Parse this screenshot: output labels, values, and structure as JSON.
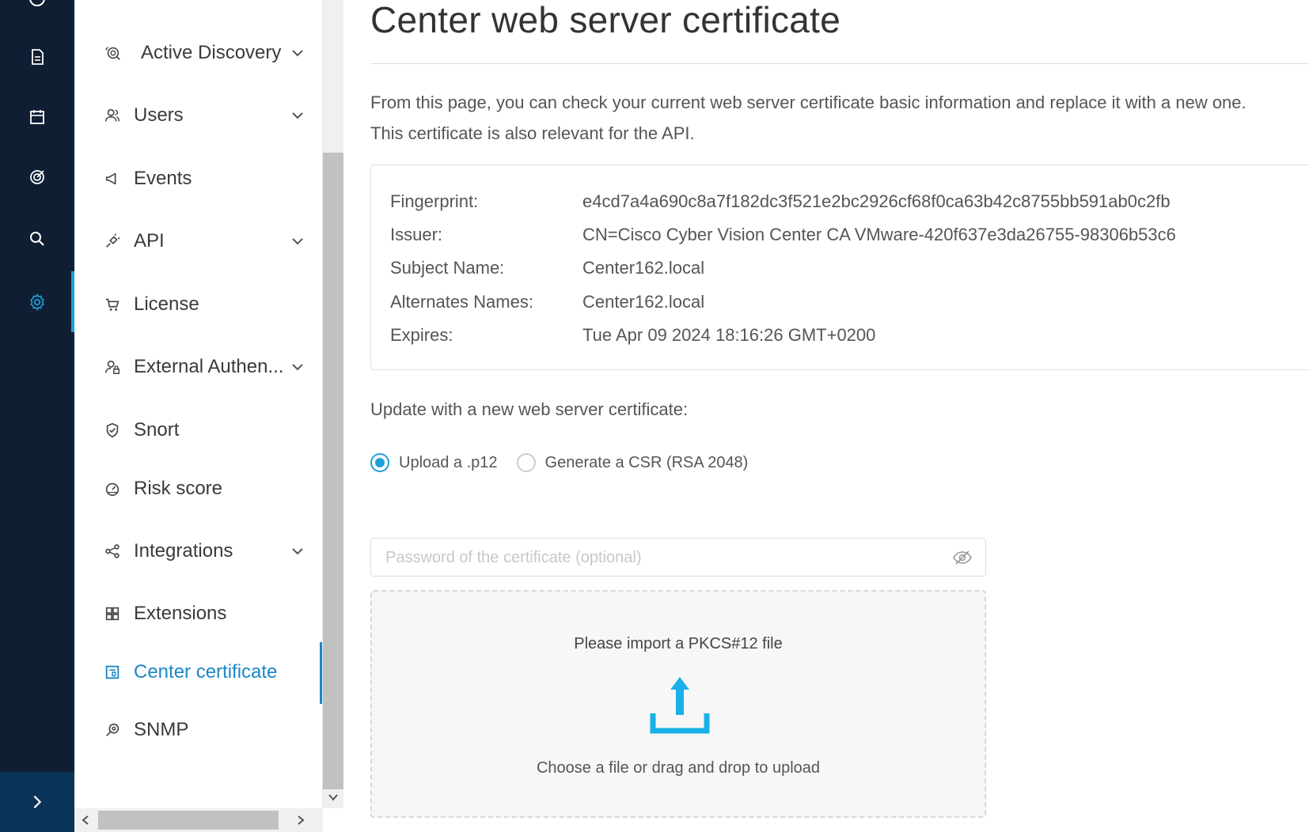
{
  "rail": {
    "icons": [
      "top-partial-icon",
      "report-icon",
      "calendar-icon",
      "target-icon",
      "search-icon",
      "gear-icon"
    ],
    "active_color": "#1ea0d8",
    "expand_icon": "chevron-right-icon"
  },
  "nav": {
    "items": [
      {
        "label": "Active Discovery",
        "icon": "discovery-icon",
        "expandable": true
      },
      {
        "label": "Users",
        "icon": "users-icon",
        "expandable": true
      },
      {
        "label": "Events",
        "icon": "megaphone-icon",
        "expandable": false
      },
      {
        "label": "API",
        "icon": "plug-icon",
        "expandable": true
      },
      {
        "label": "License",
        "icon": "cart-icon",
        "expandable": false
      },
      {
        "label": "External Authen...",
        "icon": "user-lock-icon",
        "expandable": true
      },
      {
        "label": "Snort",
        "icon": "shield-check-icon",
        "expandable": false
      },
      {
        "label": "Risk score",
        "icon": "gauge-icon",
        "expandable": false
      },
      {
        "label": "Integrations",
        "icon": "share-icon",
        "expandable": true
      },
      {
        "label": "Extensions",
        "icon": "grid-icon",
        "expandable": false
      },
      {
        "label": "Center certificate",
        "icon": "certificate-icon",
        "expandable": false,
        "active": true
      },
      {
        "label": "SNMP",
        "icon": "snmp-icon",
        "expandable": false
      }
    ],
    "active_color": "#1a86c8"
  },
  "main": {
    "title": "Center web server certificate",
    "description_line1": "From this page, you can check your current web server certificate basic information and replace it with a new one.",
    "description_line2": "This certificate is also relevant for the API.",
    "cert": {
      "fingerprint_label": "Fingerprint:",
      "fingerprint": "e4cd7a4a690c8a7f182dc3f521e2bc2926cf68f0ca63b42c8755bb591ab0c2fb",
      "issuer_label": "Issuer:",
      "issuer": "CN=Cisco Cyber Vision Center CA VMware-420f637e3da26755-98306b53c6",
      "subject_label": "Subject Name:",
      "subject": "Center162.local",
      "alternates_label": "Alternates Names:",
      "alternates": "Center162.local",
      "expires_label": "Expires:",
      "expires": "Tue Apr 09 2024 18:16:26 GMT+0200"
    },
    "update_label": "Update with a new web server certificate:",
    "radio_upload": "Upload a .p12",
    "radio_csr": "Generate a CSR (RSA 2048)",
    "selected_option": "Upload a .p12",
    "password_placeholder": "Password of the certificate (optional)",
    "password_value": "",
    "dropzone_title": "Please import a PKCS#12 file",
    "dropzone_sub": "Choose a file or drag and drop to upload",
    "upload_color": "#1ab0e8"
  }
}
